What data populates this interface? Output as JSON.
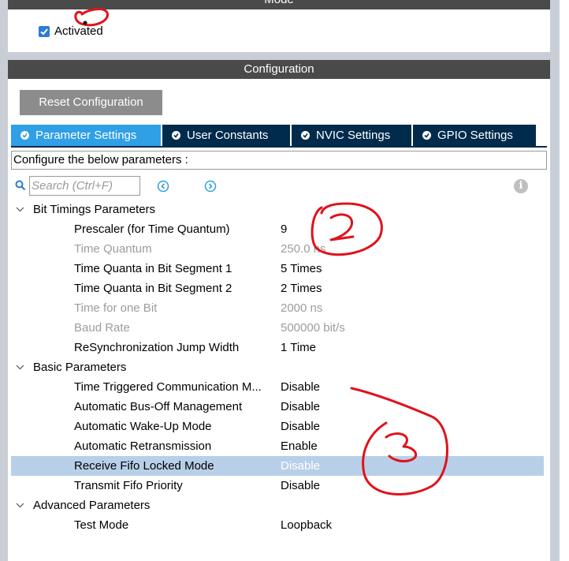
{
  "mode": {
    "title": "Mode",
    "activated_label": "Activated",
    "activated_checked": true
  },
  "configuration": {
    "title": "Configuration",
    "reset_button": "Reset Configuration",
    "tabs": [
      {
        "label": "Parameter Settings",
        "active": true
      },
      {
        "label": "User Constants",
        "active": false
      },
      {
        "label": "NVIC Settings",
        "active": false
      },
      {
        "label": "GPIO Settings",
        "active": false
      }
    ],
    "instruction": "Configure the below parameters :",
    "search_placeholder": "Search (Ctrl+F)",
    "groups": [
      {
        "label": "Bit Timings Parameters",
        "params": [
          {
            "name": "Prescaler (for Time Quantum)",
            "value": "9",
            "readonly": false
          },
          {
            "name": "Time Quantum",
            "value": "250.0 ns",
            "readonly": true
          },
          {
            "name": "Time Quanta in Bit Segment 1",
            "value": "5 Times",
            "readonly": false
          },
          {
            "name": "Time Quanta in Bit Segment 2",
            "value": "2 Times",
            "readonly": false
          },
          {
            "name": "Time for one Bit",
            "value": "2000 ns",
            "readonly": true
          },
          {
            "name": "Baud Rate",
            "value": "500000 bit/s",
            "readonly": true
          },
          {
            "name": "ReSynchronization Jump Width",
            "value": "1 Time",
            "readonly": false
          }
        ]
      },
      {
        "label": "Basic Parameters",
        "params": [
          {
            "name": "Time Triggered Communication M...",
            "value": "Disable",
            "readonly": false
          },
          {
            "name": "Automatic Bus-Off Management",
            "value": "Disable",
            "readonly": false
          },
          {
            "name": "Automatic Wake-Up Mode",
            "value": "Disable",
            "readonly": false
          },
          {
            "name": "Automatic Retransmission",
            "value": "Enable",
            "readonly": false
          },
          {
            "name": "Receive Fifo Locked Mode",
            "value": "Disable",
            "readonly": false,
            "selected": true
          },
          {
            "name": "Transmit Fifo Priority",
            "value": "Disable",
            "readonly": false
          }
        ]
      },
      {
        "label": "Advanced Parameters",
        "params": [
          {
            "name": "Test Mode",
            "value": "Loopback",
            "readonly": false
          }
        ]
      }
    ]
  },
  "icons": {
    "search": "search-icon",
    "prev": "chevron-left-circle-icon",
    "next": "chevron-right-circle-icon",
    "info": "info-icon",
    "tab_status": "check-circle-icon",
    "group_toggle": "chevron-down-icon"
  },
  "colors": {
    "header_bar": "#4a4a4a",
    "tab_active": "#2f9fe6",
    "tab_inactive": "#002b4c",
    "reset_button": "#8c8c8c",
    "selected_row": "#b8cfe8",
    "readonly_text": "#9c9c9c",
    "annotation_red": "#e0121b"
  }
}
